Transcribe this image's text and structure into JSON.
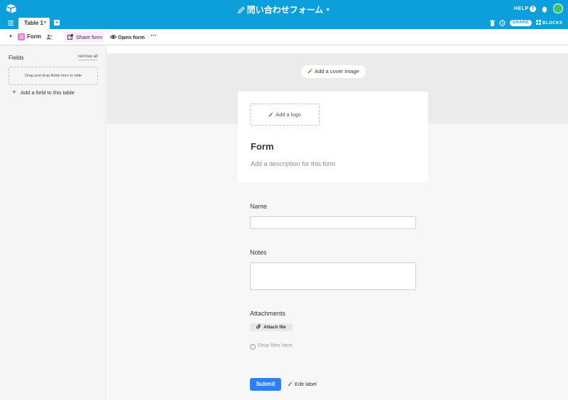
{
  "topbar": {
    "title": "問い合わせフォーム",
    "help_label": "HELP",
    "help_icon_glyph": "?",
    "share_label": "SHARE",
    "blocks_label": "BLOCKS",
    "tab_label": "Table 1",
    "add_tab_glyph": "+",
    "icons": [
      "airtable-logo-icon",
      "pencil-icon",
      "chevron-down-icon",
      "help-icon",
      "bell-icon",
      "avatar",
      "menu-icon",
      "trash-icon",
      "history-icon",
      "blocks-icon"
    ],
    "accent_color": "#0d9fdc"
  },
  "viewbar": {
    "view_name": "Form",
    "share_form_label": "Share form",
    "open_form_label": "Open form",
    "more_glyph": "···"
  },
  "leftpanel": {
    "title": "Fields",
    "remove_all_label": "remove all",
    "dropzone_text": "Drag and drop fields here to hide",
    "add_field_label": "Add a field to this table",
    "add_field_glyph": "+"
  },
  "form": {
    "cover_button_label": "Add a cover image",
    "logo_button_label": "Add a logo",
    "title": "Form",
    "description_placeholder": "Add a description for this form",
    "fields": {
      "name_label": "Name",
      "notes_label": "Notes",
      "attachments_label": "Attachments"
    },
    "attach_button_label": "Attach file",
    "drop_files_label": "Drop files here",
    "info_glyph": "i",
    "submit_label": "Submit",
    "edit_label": "Edit label",
    "submit_color": "#2d7ff9"
  }
}
